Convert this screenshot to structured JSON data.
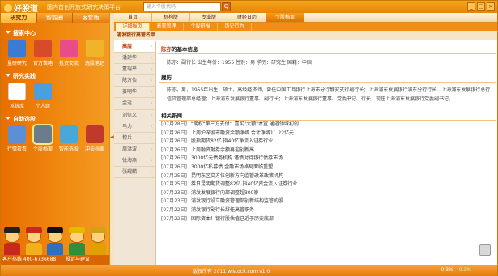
{
  "app": {
    "logo_text": "好股道",
    "slogan": "国内首创开放式研究决策平台",
    "search_placeholder": "输入个股代码",
    "search_go": "Q",
    "window_buttons": [
      "_",
      "□",
      "×"
    ]
  },
  "left_panel": {
    "tabs": [
      "研究力",
      "智能圈",
      "客套版"
    ],
    "sections": [
      {
        "title": "搜索中心",
        "items": [
          {
            "label": "量研研究",
            "icon": "research-icon",
            "color": "#3c7bd4"
          },
          {
            "label": "官方策略",
            "icon": "strategy-icon",
            "color": "#d84b2a"
          },
          {
            "label": "投资交流",
            "icon": "chat-icon",
            "color": "#e84d8a"
          },
          {
            "label": "选股笔记",
            "icon": "notes-icon",
            "color": "#f0b42a"
          }
        ]
      },
      {
        "title": "研究实践",
        "items": [
          {
            "label": "系统库",
            "icon": "system-library-icon",
            "color": "#ffffff"
          },
          {
            "label": "个人组",
            "icon": "personal-group-icon",
            "color": "#4a9fe0"
          }
        ]
      },
      {
        "title": "自助选股",
        "items": [
          {
            "label": "行情看看",
            "icon": "market-icon",
            "color": "#5b8fd8"
          },
          {
            "label": "个股档案",
            "icon": "stock-profile-icon",
            "color": "#6b7c8c"
          },
          {
            "label": "智能选股",
            "icon": "smart-pick-icon",
            "color": "#4aa8d8"
          },
          {
            "label": "冲击档案",
            "icon": "treasure-icon",
            "color": "#c0392b"
          }
        ]
      }
    ],
    "footer": {
      "hotline": "客户热线 400-6736688",
      "vote": "投诉与建议"
    }
  },
  "main": {
    "nav_tabs": [
      "首页",
      "机构版",
      "专业版",
      "财经日历",
      "个股档案"
    ],
    "active_nav_index": 4,
    "sub_tabs": [
      "详细报页",
      "高管管理",
      "个股研报",
      "历史行为"
    ],
    "active_sub_index": 0,
    "page_title": "浦发银行高管名单",
    "side_menu": [
      "高层",
      "潘建华",
      "董瑞平",
      "陈方怡",
      "姜明华",
      "金远",
      "刘信义",
      "马力",
      "穆兵",
      "周洪波",
      "徐海燕",
      "张耀麟"
    ],
    "active_side_index": 0,
    "person": {
      "name": "陈亦",
      "heading_suffix": "的基本信息",
      "info_line": "陈亦：副行长  出生年份：1955 性别：男  学历：研究生  国籍：中国",
      "resume_title": "履历",
      "resume": "陈亦，男，1955年出生，硕士，高级经济师。曾任中国工商银行上海市分行静安支行副行长；上海浦东发展银行浦东分行行长、上海浦东发展银行总行信贷管理部总经理；上海浦东发展银行董事、副行长；上海浦东发展银行董事、党委书记、行长，现任上海浦东发展银行党委副书记。"
    },
    "news": {
      "title": "相关新闻",
      "items": [
        {
          "date": "[07月28日]",
          "text": "\"期权\"第三方支付：嘉实\"大额\"本宣 通道领域初创"
        },
        {
          "date": "[07月26日]",
          "text": "上周沪深股市融资余额净增 合计净增11.22亿元"
        },
        {
          "date": "[07月26日]",
          "text": "股指期货82亿 指40亿净流入证券行业"
        },
        {
          "date": "[07月26日]",
          "text": "上周融资融券余额再迎创新高"
        },
        {
          "date": "[07月26日]",
          "text": "3000亿元债务机构 谨慎对待银行债券市场"
        },
        {
          "date": "[07月26日]",
          "text": "3000亿私募债 金融市场格局面临重塑"
        },
        {
          "date": "[07月25日]",
          "text": "昆明东区交方位创新方向监管改革政策机构"
        },
        {
          "date": "[07月25日]",
          "text": "券日昆明期货调整82亿 指40亿资金流入证券行业"
        },
        {
          "date": "[07月23日]",
          "text": "浦发发展银行内部调整超300家"
        },
        {
          "date": "[07月23日]",
          "text": "浦发银行设立融资管理部创新结构监管的股"
        },
        {
          "date": "[07月22日]",
          "text": "浦发银行副行长辞任高管职务"
        },
        {
          "date": "[07月22日]",
          "text": "国际资本！银行股估值已近于历史底部"
        }
      ]
    }
  },
  "status_bar": {
    "copyright": "版权所有 2011 wlstock.com v1.0",
    "indices": [
      {
        "name": "0.3%",
        "color": "#ffffff"
      },
      {
        "name": "0.3%",
        "color": "#b6ffb6"
      }
    ]
  }
}
